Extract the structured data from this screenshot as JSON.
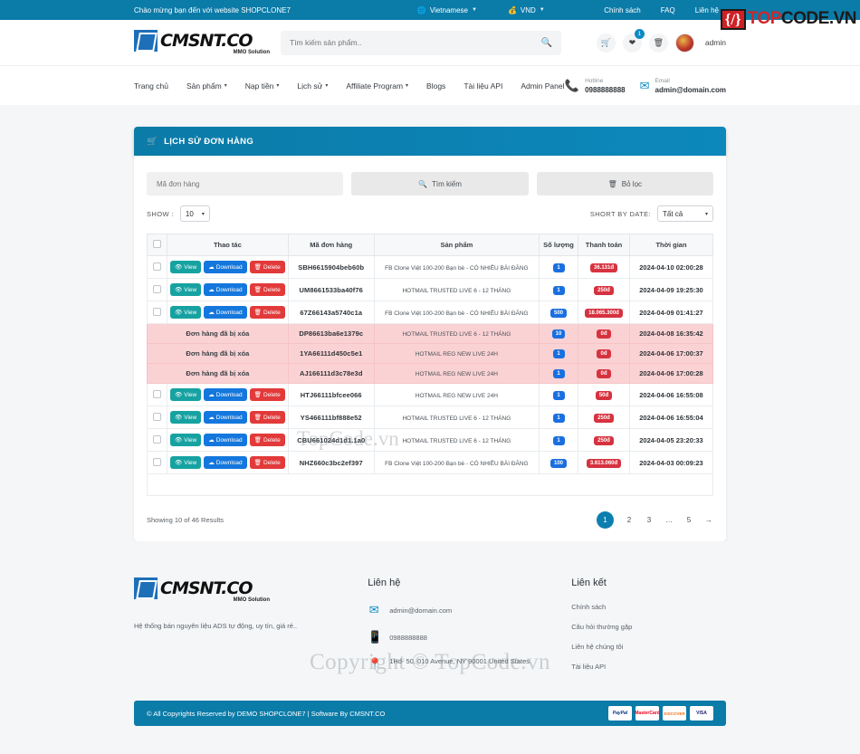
{
  "topbar": {
    "welcome": "Chào mừng bạn đến với website SHOPCLONE7",
    "language": "Vietnamese",
    "currency": "VND",
    "links": [
      "Chính sách",
      "FAQ",
      "Liên hệ"
    ],
    "logo_badge": "{/}",
    "logo_top": "TOP",
    "logo_code": "CODE.VN"
  },
  "brand": {
    "name": "CMSNT.CO",
    "sub": "MMO Solution"
  },
  "search": {
    "placeholder": "Tìm kiếm sản phẩm..",
    "value": ""
  },
  "header": {
    "cart_icon": "cart-icon",
    "wishlist_badge": "1",
    "username": "admin"
  },
  "nav": {
    "items": [
      {
        "label": "Trang chủ",
        "caret": ""
      },
      {
        "label": "Sản phẩm",
        "caret": "⌄"
      },
      {
        "label": "Nạp tiền",
        "caret": "⌄"
      },
      {
        "label": "Lịch sử",
        "caret": "⌄"
      },
      {
        "label": "Affiliate Program",
        "caret": "⌄"
      },
      {
        "label": "Blogs",
        "caret": ""
      },
      {
        "label": "Tài liệu API",
        "caret": ""
      },
      {
        "label": "Admin Panel",
        "caret": ""
      }
    ],
    "hotline_label": "Hotline",
    "hotline_value": "0988888888",
    "email_label": "Email",
    "email_value": "admin@domain.com"
  },
  "panel": {
    "title": "LỊCH SỬ ĐƠN HÀNG",
    "filter_placeholder": "Mã đơn hàng",
    "search_button": "Tìm kiếm",
    "clear_button": "Bỏ lọc",
    "show_label": "SHOW :",
    "show_value": "10",
    "sort_label": "SHORT BY DATE:",
    "sort_value": "Tất cả"
  },
  "table": {
    "headers": [
      "",
      "Thao tác",
      "Mã đơn hàng",
      "Sản phẩm",
      "Số lượng",
      "Thanh toán",
      "Thời gian"
    ],
    "action_labels": {
      "view": "View",
      "download": "Download",
      "delete": "Delete"
    },
    "deleted_message": "Đơn hàng đã bị xóa",
    "rows": [
      {
        "deleted": false,
        "code": "SBH6615904beb60b",
        "product": "FB Clone Việt 100-200 Bạn bè - CÓ NHIỀU BÀI ĐĂNG",
        "qty": "1",
        "payment": "36.131đ",
        "time": "2024-04-10 02:00:28"
      },
      {
        "deleted": false,
        "code": "UM8661533ba40f76",
        "product": "HOTMAIL TRUSTED LIVE 6 - 12 THÁNG",
        "qty": "1",
        "payment": "250đ",
        "time": "2024-04-09 19:25:30"
      },
      {
        "deleted": false,
        "code": "67Z66143a5740c1a",
        "product": "FB Clone Việt 100-200 Bạn bè - CÓ NHIỀU BÀI ĐĂNG",
        "qty": "500",
        "payment": "18.065.300đ",
        "time": "2024-04-09 01:41:27"
      },
      {
        "deleted": true,
        "code": "DP86613ba6e1379c",
        "product": "HOTMAIL TRUSTED LIVE 6 - 12 THÁNG",
        "qty": "10",
        "payment": "0đ",
        "time": "2024-04-08 16:35:42"
      },
      {
        "deleted": true,
        "code": "1YA66111d450c5e1",
        "product": "HOTMAIL REG NEW LIVE 24H",
        "qty": "1",
        "payment": "0đ",
        "time": "2024-04-06 17:00:37"
      },
      {
        "deleted": true,
        "code": "AJ166111d3c78e3d",
        "product": "HOTMAIL REG NEW LIVE 24H",
        "qty": "1",
        "payment": "0đ",
        "time": "2024-04-06 17:00:28"
      },
      {
        "deleted": false,
        "code": "HTJ66111bfcee066",
        "product": "HOTMAIL REG NEW LIVE 24H",
        "qty": "1",
        "payment": "50đ",
        "time": "2024-04-06 16:55:08"
      },
      {
        "deleted": false,
        "code": "YS466111bf888e52",
        "product": "HOTMAIL TRUSTED LIVE 6 - 12 THÁNG",
        "qty": "1",
        "payment": "250đ",
        "time": "2024-04-06 16:55:04"
      },
      {
        "deleted": false,
        "code": "CBU661024d1d1.1a0",
        "product": "HOTMAIL TRUSTED LIVE 6 - 12 THÁNG",
        "qty": "1",
        "payment": "250đ",
        "time": "2024-04-05 23:20:33"
      },
      {
        "deleted": false,
        "code": "NHZ660c3bc2ef397",
        "product": "FB Clone Việt 100-200 Bạn bè - CÓ NHIỀU BÀI ĐĂNG",
        "qty": "100",
        "payment": "3.613.060đ",
        "time": "2024-04-03 00:09:23"
      }
    ]
  },
  "pagination": {
    "showing": "Showing 10 of 46 Results",
    "pages": [
      "1",
      "2",
      "3",
      "…",
      "5"
    ],
    "active": "1",
    "next_icon": "→"
  },
  "footer": {
    "brand_name": "CMSNT.CO",
    "brand_sub": "MMO Solution",
    "description": "Hệ thống bán nguyên liệu ADS tự động, uy tín, giá rẻ..",
    "contact_title": "Liên hệ",
    "contacts": [
      {
        "icon": "at-icon",
        "glyph": "@",
        "value": "admin@domain.com"
      },
      {
        "icon": "phone-icon",
        "glyph": "▯",
        "value": "0988888888"
      },
      {
        "icon": "location-pin-icon",
        "glyph": "◉",
        "value": "1Hd- 50, 010 Avenue, NY 90001 United States"
      }
    ],
    "links_title": "Liên kết",
    "links": [
      "Chính sách",
      "Câu hỏi thường gặp",
      "Liên hệ chúng tôi",
      "Tài liệu API"
    ],
    "copyright": "© All Copyrights Reserved by DEMO SHOPCLONE7 | Software By CMSNT.CO",
    "cards": [
      "PayPal",
      "MasterCard",
      "DISCOVER",
      "VISA"
    ]
  },
  "watermark": {
    "table": "TopCode.vn",
    "footer": "Copyright © TopCode.vn"
  },
  "colors": {
    "primary": "#0b7ba8",
    "danger": "#d7323f",
    "info": "#1a6fe0",
    "teal": "#17a2a2",
    "deleted_row": "#fbd2d4"
  }
}
